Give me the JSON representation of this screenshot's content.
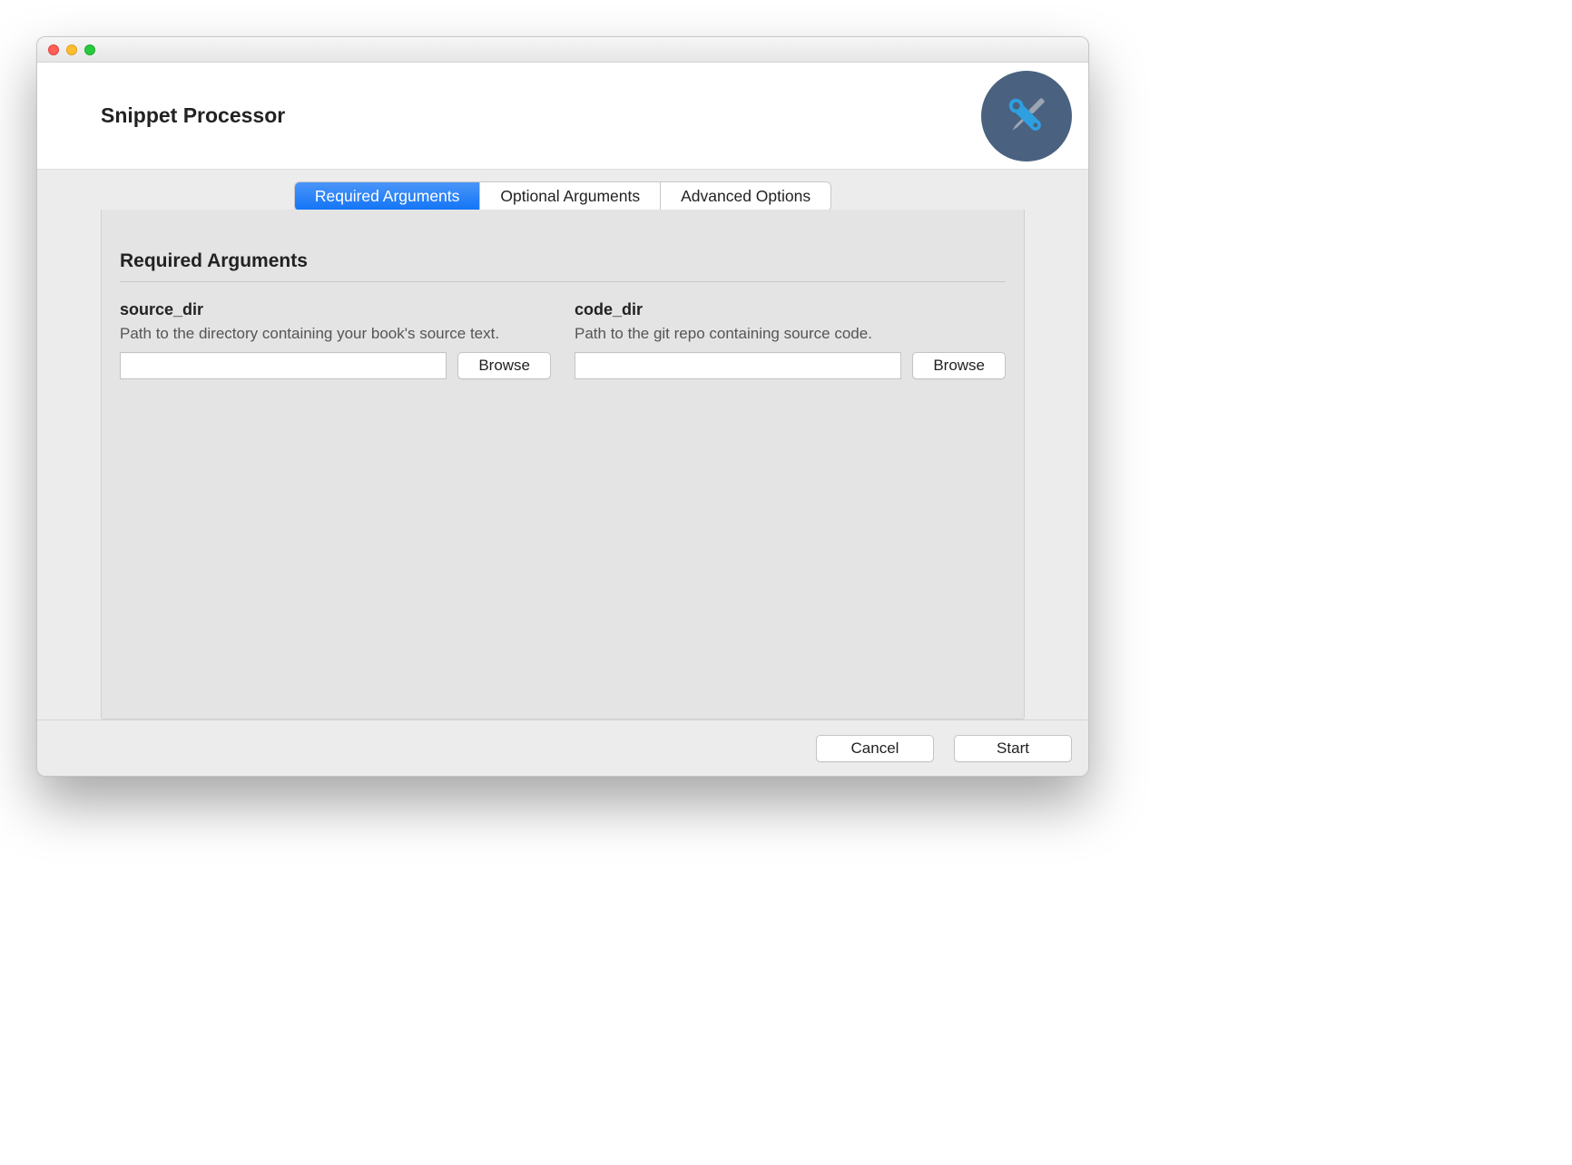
{
  "window": {
    "title": "Snippet Processor"
  },
  "tabs": [
    {
      "label": "Required Arguments",
      "active": true
    },
    {
      "label": "Optional Arguments",
      "active": false
    },
    {
      "label": "Advanced Options",
      "active": false
    }
  ],
  "section": {
    "title": "Required Arguments"
  },
  "fields": {
    "source_dir": {
      "name": "source_dir",
      "description": "Path to the directory containing your book's source text.",
      "value": "",
      "browse_label": "Browse"
    },
    "code_dir": {
      "name": "code_dir",
      "description": "Path to the git repo containing source code.",
      "value": "",
      "browse_label": "Browse"
    }
  },
  "footer": {
    "cancel": "Cancel",
    "start": "Start"
  },
  "icon": {
    "name": "tools-icon"
  }
}
